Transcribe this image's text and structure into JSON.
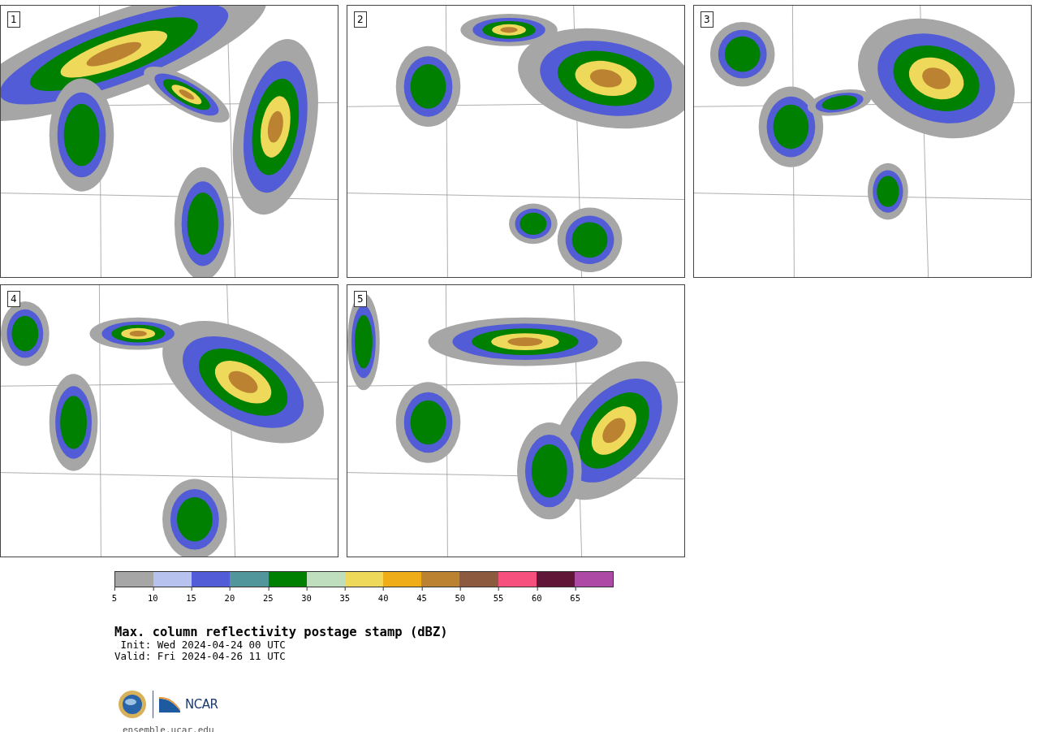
{
  "panels": [
    {
      "label": "1"
    },
    {
      "label": "2"
    },
    {
      "label": "3"
    },
    {
      "label": "4"
    },
    {
      "label": "5"
    }
  ],
  "colorbar": {
    "bins": [
      {
        "color": "#a6a6a6"
      },
      {
        "color": "#b8c2ee"
      },
      {
        "color": "#525cd6"
      },
      {
        "color": "#50969b"
      },
      {
        "color": "#008000"
      },
      {
        "color": "#bedebe"
      },
      {
        "color": "#efd95a"
      },
      {
        "color": "#efae18"
      },
      {
        "color": "#bb8231"
      },
      {
        "color": "#8b5a3f"
      },
      {
        "color": "#f5507e"
      },
      {
        "color": "#601636"
      },
      {
        "color": "#ad4aa5"
      }
    ],
    "ticks": [
      "5",
      "10",
      "15",
      "20",
      "25",
      "30",
      "35",
      "40",
      "45",
      "50",
      "55",
      "60",
      "65"
    ]
  },
  "title": "Max. column reflectivity postage stamp (dBZ)",
  "init": " Init: Wed 2024-04-24 00 UTC",
  "valid": "Valid: Fri 2024-04-26 11 UTC",
  "logo": {
    "text": "NCAR"
  },
  "url": "ensemble.ucar.edu"
}
